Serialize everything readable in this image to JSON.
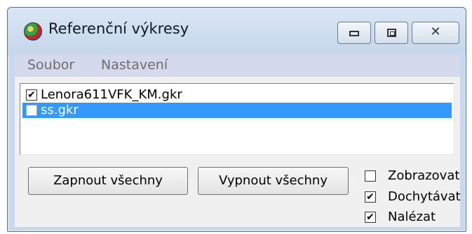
{
  "window": {
    "title": "Referenční výkresy",
    "controls": {
      "minimize_icon": "minimize-icon",
      "maximize_icon": "maximize-icon",
      "close_glyph": "☒"
    }
  },
  "menu": {
    "items": [
      "Soubor",
      "Nastavení"
    ]
  },
  "list": {
    "items": [
      {
        "label": "Lenora611VFK_KM.gkr",
        "checked": true,
        "selected": false
      },
      {
        "label": "ss.gkr",
        "checked": false,
        "selected": true
      }
    ]
  },
  "buttons": {
    "enable_all": "Zapnout všechny",
    "disable_all": "Vypnout všechny"
  },
  "options": [
    {
      "label": "Zobrazovat",
      "checked": false
    },
    {
      "label": "Dochytávat",
      "checked": true
    },
    {
      "label": "Nalézat",
      "checked": true
    }
  ],
  "colors": {
    "selection": "#3399ff",
    "window_frame": "#c9d8ea",
    "menubar": "#d4d9ec"
  }
}
